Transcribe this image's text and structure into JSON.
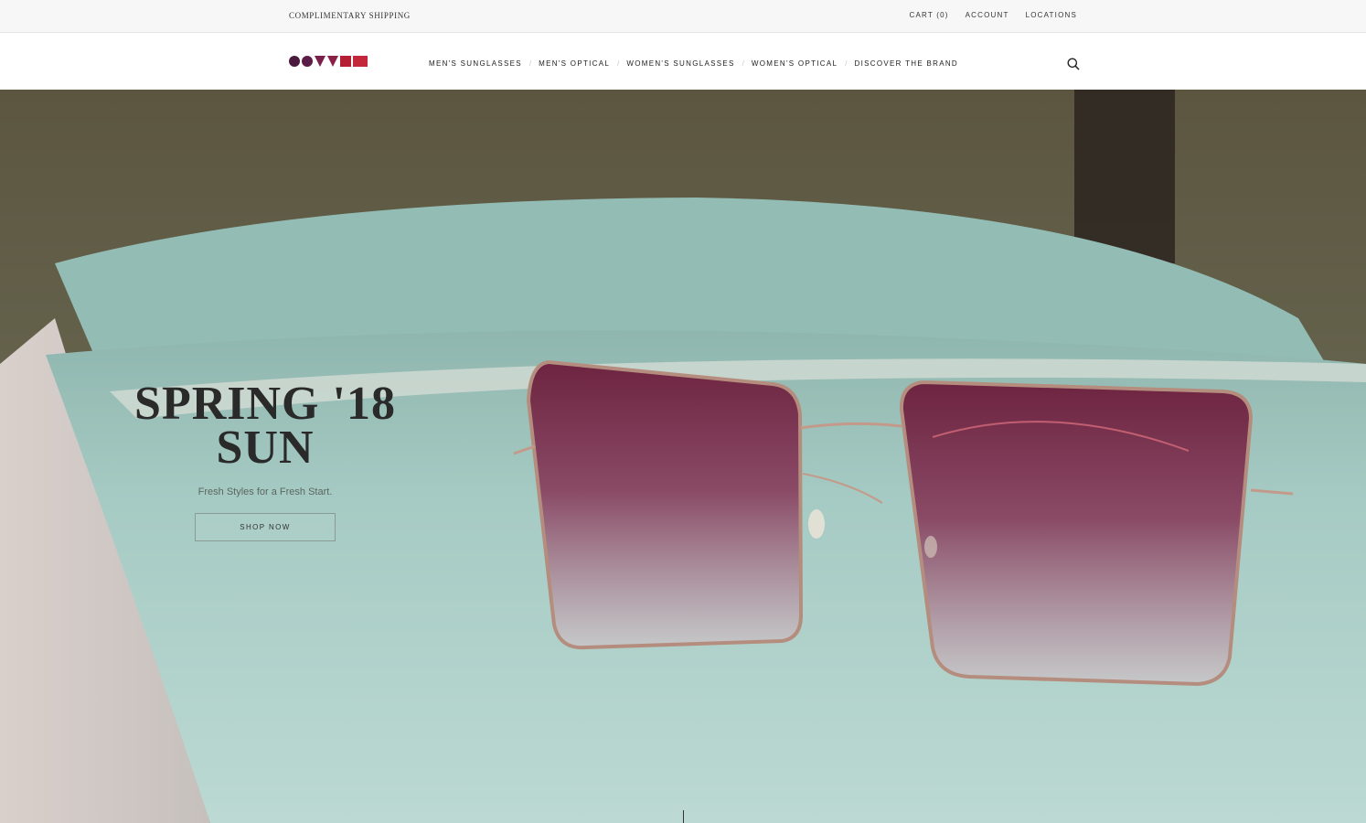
{
  "utility": {
    "shipping": "COMPLIMENTARY SHIPPING",
    "cart": "CART (0)",
    "account": "ACCOUNT",
    "locations": "LOCATIONS"
  },
  "header": {
    "logo_icon": "brand-shapes-logo",
    "nav": [
      {
        "label": "MEN'S SUNGLASSES"
      },
      {
        "label": "MEN'S OPTICAL"
      },
      {
        "label": "WOMEN'S SUNGLASSES"
      },
      {
        "label": "WOMEN'S OPTICAL"
      },
      {
        "label": "DISCOVER THE BRAND"
      }
    ],
    "nav_separator": "/",
    "search_icon": "search-icon"
  },
  "hero": {
    "title_line1": "SPRING '18",
    "title_line2": "SUN",
    "subtitle": "Fresh Styles for a Fresh Start.",
    "cta": "SHOP NOW"
  },
  "colors": {
    "lens": "#7a2f4a",
    "frame": "#b88a7a",
    "velvet": "#a9cdc7",
    "brand_purple": "#4a1a3d",
    "brand_red": "#b41f36"
  }
}
